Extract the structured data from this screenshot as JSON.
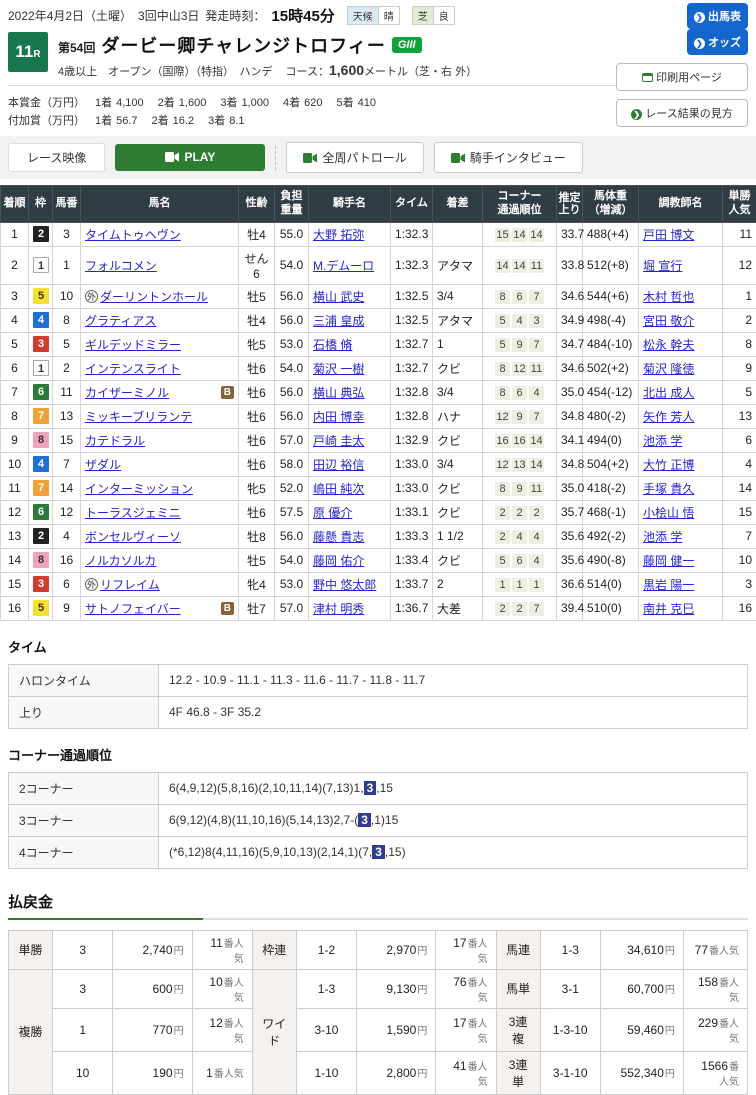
{
  "header": {
    "date": "2022年4月2日（土曜）",
    "meeting": "3回中山3日",
    "start_label": "発走時刻：",
    "start_time": "15時45分",
    "weather_label": "天候",
    "weather_value": "晴",
    "track_label": "芝",
    "track_value": "良",
    "btn_entries": "出馬表",
    "btn_odds": "オッズ",
    "btn_print": "印刷用ページ",
    "btn_guide": "レース結果の見方",
    "race_number": "11",
    "race_number_suffix": "R",
    "edition": "第54回",
    "title": "ダービー卿チャレンジトロフィー",
    "grade": "GIII",
    "conditions": "4歳以上　オープン（国際）（特指）　ハンデ",
    "course_label": "コース：",
    "course_distance": "1,600",
    "course_detail": "メートル（芝・右 外）",
    "prize_main_label": "本賞金（万円）",
    "prize_main": [
      [
        "1着",
        "4,100"
      ],
      [
        "2着",
        "1,600"
      ],
      [
        "3着",
        "1,000"
      ],
      [
        "4着",
        "620"
      ],
      [
        "5着",
        "410"
      ]
    ],
    "prize_add_label": "付加賞（万円）",
    "prize_add": [
      [
        "1着",
        "56.7"
      ],
      [
        "2着",
        "16.2"
      ],
      [
        "3着",
        "8.1"
      ]
    ]
  },
  "video": {
    "label": "レース映像",
    "play": "PLAY",
    "patrol": "全周パトロール",
    "interview": "騎手インタビュー"
  },
  "accent_colors": {
    "green": "#2e7d32",
    "blue": "#1565cf",
    "grade_green": "#12a13b",
    "table_header": "#313d44",
    "corner_highlight": "#2f3c8f"
  },
  "frame_colors": {
    "1": {
      "bg": "#ffffff",
      "fg": "#333333",
      "border": "#aaaaaa"
    },
    "2": {
      "bg": "#222222",
      "fg": "#ffffff"
    },
    "3": {
      "bg": "#d33b2f",
      "fg": "#ffffff"
    },
    "4": {
      "bg": "#1d71d6",
      "fg": "#ffffff"
    },
    "5": {
      "bg": "#f7e32f",
      "fg": "#333333"
    },
    "6": {
      "bg": "#2c7b3a",
      "fg": "#ffffff"
    },
    "7": {
      "bg": "#f2a136",
      "fg": "#ffffff"
    },
    "8": {
      "bg": "#f2a2bb",
      "fg": "#333333"
    }
  },
  "results": {
    "columns": {
      "pos": "着順",
      "frame": "枠",
      "num": "馬番",
      "horse": "馬名",
      "sexage": "性齢",
      "weight": "負担\n重量",
      "jockey": "騎手名",
      "time": "タイム",
      "margin": "着差",
      "corners": "コーナー\n通過順位",
      "last3f": "推定上り",
      "body": "馬体重\n（増減）",
      "trainer": "調教師名",
      "pop": "単勝\n人気"
    },
    "rows": [
      {
        "pos": "1",
        "frame": "2",
        "num": "3",
        "mark": "",
        "horse": "タイムトゥヘヴン",
        "blinker": "",
        "sexage": "牡4",
        "weight": "55.0",
        "jockey": "大野 拓弥",
        "time": "1:32.3",
        "margin": "",
        "corners": [
          "15",
          "14",
          "14"
        ],
        "last3f": "33.7",
        "body": "488(+4)",
        "trainer": "戸田 博文",
        "pop": "11"
      },
      {
        "pos": "2",
        "frame": "1",
        "num": "1",
        "mark": "",
        "horse": "フォルコメン",
        "blinker": "",
        "sexage": "せん6",
        "weight": "54.0",
        "jockey": "M.デムーロ",
        "time": "1:32.3",
        "margin": "アタマ",
        "corners": [
          "14",
          "14",
          "11"
        ],
        "last3f": "33.8",
        "body": "512(+8)",
        "trainer": "堀 宣行",
        "pop": "12"
      },
      {
        "pos": "3",
        "frame": "5",
        "num": "10",
        "mark": "外",
        "horse": "ダーリントンホール",
        "blinker": "",
        "sexage": "牡5",
        "weight": "56.0",
        "jockey": "横山 武史",
        "time": "1:32.5",
        "margin": "3/4",
        "corners": [
          "8",
          "6",
          "7"
        ],
        "last3f": "34.6",
        "body": "544(+6)",
        "trainer": "木村 哲也",
        "pop": "1"
      },
      {
        "pos": "4",
        "frame": "4",
        "num": "8",
        "mark": "",
        "horse": "グラティアス",
        "blinker": "",
        "sexage": "牡4",
        "weight": "56.0",
        "jockey": "三浦 皇成",
        "time": "1:32.5",
        "margin": "アタマ",
        "corners": [
          "5",
          "4",
          "3"
        ],
        "last3f": "34.9",
        "body": "498(-4)",
        "trainer": "宮田 敬介",
        "pop": "2"
      },
      {
        "pos": "5",
        "frame": "3",
        "num": "5",
        "mark": "",
        "horse": "ギルデッドミラー",
        "blinker": "",
        "sexage": "牝5",
        "weight": "53.0",
        "jockey": "石橋 脩",
        "time": "1:32.7",
        "margin": "1",
        "corners": [
          "5",
          "9",
          "7"
        ],
        "last3f": "34.7",
        "body": "484(-10)",
        "trainer": "松永 幹夫",
        "pop": "8"
      },
      {
        "pos": "6",
        "frame": "1",
        "num": "2",
        "mark": "",
        "horse": "インテンスライト",
        "blinker": "",
        "sexage": "牡6",
        "weight": "54.0",
        "jockey": "菊沢 一樹",
        "time": "1:32.7",
        "margin": "クビ",
        "corners": [
          "8",
          "12",
          "11"
        ],
        "last3f": "34.6",
        "body": "502(+2)",
        "trainer": "菊沢 隆徳",
        "pop": "9"
      },
      {
        "pos": "7",
        "frame": "6",
        "num": "11",
        "mark": "",
        "horse": "カイザーミノル",
        "blinker": "B",
        "sexage": "牡6",
        "weight": "56.0",
        "jockey": "横山 典弘",
        "time": "1:32.8",
        "margin": "3/4",
        "corners": [
          "8",
          "6",
          "4"
        ],
        "last3f": "35.0",
        "body": "454(-12)",
        "trainer": "北出 成人",
        "pop": "5"
      },
      {
        "pos": "8",
        "frame": "7",
        "num": "13",
        "mark": "",
        "horse": "ミッキーブリランテ",
        "blinker": "",
        "sexage": "牡6",
        "weight": "56.0",
        "jockey": "内田 博幸",
        "time": "1:32.8",
        "margin": "ハナ",
        "corners": [
          "12",
          "9",
          "7"
        ],
        "last3f": "34.8",
        "body": "480(-2)",
        "trainer": "矢作 芳人",
        "pop": "13"
      },
      {
        "pos": "9",
        "frame": "8",
        "num": "15",
        "mark": "",
        "horse": "カテドラル",
        "blinker": "",
        "sexage": "牡6",
        "weight": "57.0",
        "jockey": "戸崎 圭太",
        "time": "1:32.9",
        "margin": "クビ",
        "corners": [
          "16",
          "16",
          "14"
        ],
        "last3f": "34.1",
        "body": "494(0)",
        "trainer": "池添 学",
        "pop": "6"
      },
      {
        "pos": "10",
        "frame": "4",
        "num": "7",
        "mark": "",
        "horse": "ザダル",
        "blinker": "",
        "sexage": "牡6",
        "weight": "58.0",
        "jockey": "田辺 裕信",
        "time": "1:33.0",
        "margin": "3/4",
        "corners": [
          "12",
          "13",
          "14"
        ],
        "last3f": "34.8",
        "body": "504(+2)",
        "trainer": "大竹 正博",
        "pop": "4"
      },
      {
        "pos": "11",
        "frame": "7",
        "num": "14",
        "mark": "",
        "horse": "インターミッション",
        "blinker": "",
        "sexage": "牝5",
        "weight": "52.0",
        "jockey": "嶋田 純次",
        "time": "1:33.0",
        "margin": "クビ",
        "corners": [
          "8",
          "9",
          "11"
        ],
        "last3f": "35.0",
        "body": "418(-2)",
        "trainer": "手塚 貴久",
        "pop": "14"
      },
      {
        "pos": "12",
        "frame": "6",
        "num": "12",
        "mark": "",
        "horse": "トーラスジェミニ",
        "blinker": "",
        "sexage": "牡6",
        "weight": "57.5",
        "jockey": "原 優介",
        "time": "1:33.1",
        "margin": "クビ",
        "corners": [
          "2",
          "2",
          "2"
        ],
        "last3f": "35.7",
        "body": "468(-1)",
        "trainer": "小桧山 悟",
        "pop": "15"
      },
      {
        "pos": "13",
        "frame": "2",
        "num": "4",
        "mark": "",
        "horse": "ボンセルヴィーソ",
        "blinker": "",
        "sexage": "牡8",
        "weight": "56.0",
        "jockey": "藤懸 貴志",
        "time": "1:33.3",
        "margin": "1 1/2",
        "corners": [
          "2",
          "4",
          "4"
        ],
        "last3f": "35.6",
        "body": "492(-2)",
        "trainer": "池添 学",
        "pop": "7"
      },
      {
        "pos": "14",
        "frame": "8",
        "num": "16",
        "mark": "",
        "horse": "ノルカソルカ",
        "blinker": "",
        "sexage": "牡5",
        "weight": "54.0",
        "jockey": "藤岡 佑介",
        "time": "1:33.4",
        "margin": "クビ",
        "corners": [
          "5",
          "6",
          "4"
        ],
        "last3f": "35.6",
        "body": "490(-8)",
        "trainer": "藤岡 健一",
        "pop": "10"
      },
      {
        "pos": "15",
        "frame": "3",
        "num": "6",
        "mark": "外",
        "horse": "リフレイム",
        "blinker": "",
        "sexage": "牝4",
        "weight": "53.0",
        "jockey": "野中 悠太郎",
        "time": "1:33.7",
        "margin": "2",
        "corners": [
          "1",
          "1",
          "1"
        ],
        "last3f": "36.6",
        "body": "514(0)",
        "trainer": "黒岩 陽一",
        "pop": "3"
      },
      {
        "pos": "16",
        "frame": "5",
        "num": "9",
        "mark": "",
        "horse": "サトノフェイバー",
        "blinker": "B",
        "sexage": "牡7",
        "weight": "57.0",
        "jockey": "津村 明秀",
        "time": "1:36.7",
        "margin": "大差",
        "corners": [
          "2",
          "2",
          "7"
        ],
        "last3f": "39.4",
        "body": "510(0)",
        "trainer": "南井 克巳",
        "pop": "16"
      }
    ]
  },
  "time_section": {
    "title": "タイム",
    "rows": [
      {
        "label": "ハロンタイム",
        "value": "12.2 - 10.9 - 11.1 - 11.3 - 11.6 - 11.7 - 11.8 - 11.7"
      },
      {
        "label": "上り",
        "value": "4F 46.8 - 3F 35.2"
      }
    ]
  },
  "corner_section": {
    "title": "コーナー通過順位",
    "rows": [
      {
        "label": "2コーナー",
        "pre": "6(4,9,12)(5,8,16)(2,10,11,14)(7,13)1,",
        "hl": "3",
        "post": ",15"
      },
      {
        "label": "3コーナー",
        "pre": "6(9,12)(4,8)(11,10,16)(5,14,13)2,7-(",
        "hl": "3",
        "post": ",1)15"
      },
      {
        "label": "4コーナー",
        "pre": "(*6,12)8(4,11,16)(5,9,10,13)(2,14,1)(7,",
        "hl": "3",
        "post": ",15)"
      }
    ]
  },
  "payout": {
    "title": "払戻金",
    "yen": "円",
    "ninki": "番人気",
    "tansho": {
      "label": "単勝",
      "combo": "3",
      "amount": "2,740",
      "pop": "11"
    },
    "fukusho": {
      "label": "複勝",
      "rows": [
        {
          "combo": "3",
          "amount": "600",
          "pop": "10"
        },
        {
          "combo": "1",
          "amount": "770",
          "pop": "12"
        },
        {
          "combo": "10",
          "amount": "190",
          "pop": "1"
        }
      ]
    },
    "wakuren": {
      "label": "枠連",
      "combo": "1-2",
      "amount": "2,970",
      "pop": "17"
    },
    "wide": {
      "label": "ワイド",
      "rows": [
        {
          "combo": "1-3",
          "amount": "9,130",
          "pop": "76"
        },
        {
          "combo": "3-10",
          "amount": "1,590",
          "pop": "17"
        },
        {
          "combo": "1-10",
          "amount": "2,800",
          "pop": "41"
        }
      ]
    },
    "umaren": {
      "label": "馬連",
      "combo": "1-3",
      "amount": "34,610",
      "pop": "77"
    },
    "umatan": {
      "label": "馬単",
      "combo": "3-1",
      "amount": "60,700",
      "pop": "158"
    },
    "sanrenpuku": {
      "label": "3連複",
      "combo": "1-3-10",
      "amount": "59,460",
      "pop": "229"
    },
    "sanrentan": {
      "label": "3連単",
      "combo": "3-1-10",
      "amount": "552,340",
      "pop": "1566"
    }
  }
}
